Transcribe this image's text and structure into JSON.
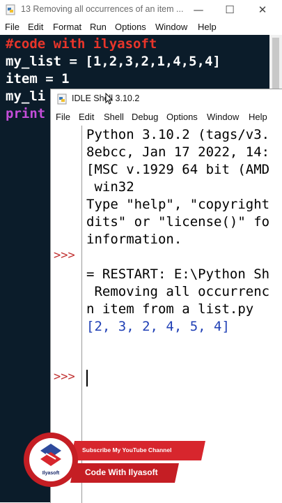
{
  "editor": {
    "title": "13 Removing all occurrences of an item ...",
    "window_controls": {
      "minimize": "—",
      "maximize": "☐",
      "close": "✕"
    },
    "menu": [
      "File",
      "Edit",
      "Format",
      "Run",
      "Options",
      "Window",
      "Help"
    ],
    "code_lines": [
      {
        "text": "#code with ilyasoft",
        "color": "#e8352a"
      },
      {
        "text": "my_list = [1,2,3,2,1,4,5,4]",
        "color": "#ffffff"
      },
      {
        "text": "item = 1",
        "color": "#ffffff"
      },
      {
        "text": "my_li",
        "color": "#ffffff"
      },
      {
        "text": "print",
        "color": "#c44dd9"
      }
    ]
  },
  "shell": {
    "title": "IDLE Shell 3.10.2",
    "menu": [
      "File",
      "Edit",
      "Shell",
      "Debug",
      "Options",
      "Window",
      "Help"
    ],
    "prompt": ">>>",
    "lines": [
      {
        "text": "Python 3.10.2 (tags/v3.",
        "color": "#000000"
      },
      {
        "text": "8ebcc, Jan 17 2022, 14:",
        "color": "#000000"
      },
      {
        "text": "[MSC v.1929 64 bit (AMD",
        "color": "#000000"
      },
      {
        "text": " win32",
        "color": "#000000"
      },
      {
        "text": "Type \"help\", \"copyright",
        "color": "#000000"
      },
      {
        "text": "dits\" or \"license()\" fo",
        "color": "#000000"
      },
      {
        "text": "information.",
        "color": "#000000"
      },
      {
        "text": "",
        "color": "#000000"
      },
      {
        "text": "= RESTART: E:\\Python Sh",
        "color": "#000000"
      },
      {
        "text": " Removing all occurrenc",
        "color": "#000000"
      },
      {
        "text": "n item from a list.py",
        "color": "#000000"
      },
      {
        "text": "[2, 3, 2, 4, 5, 4]",
        "color": "#1f3fb5"
      }
    ]
  },
  "banner": {
    "subscribe_text": "Subscribe My YouTube Channel",
    "channel_name": "Code With Ilyasoft",
    "logo_text": "Ilyasoft"
  },
  "colors": {
    "code_bg": "#0b1c2a",
    "prompt": "#c03030",
    "output": "#1f3fb5",
    "brand_red": "#c51e24"
  }
}
